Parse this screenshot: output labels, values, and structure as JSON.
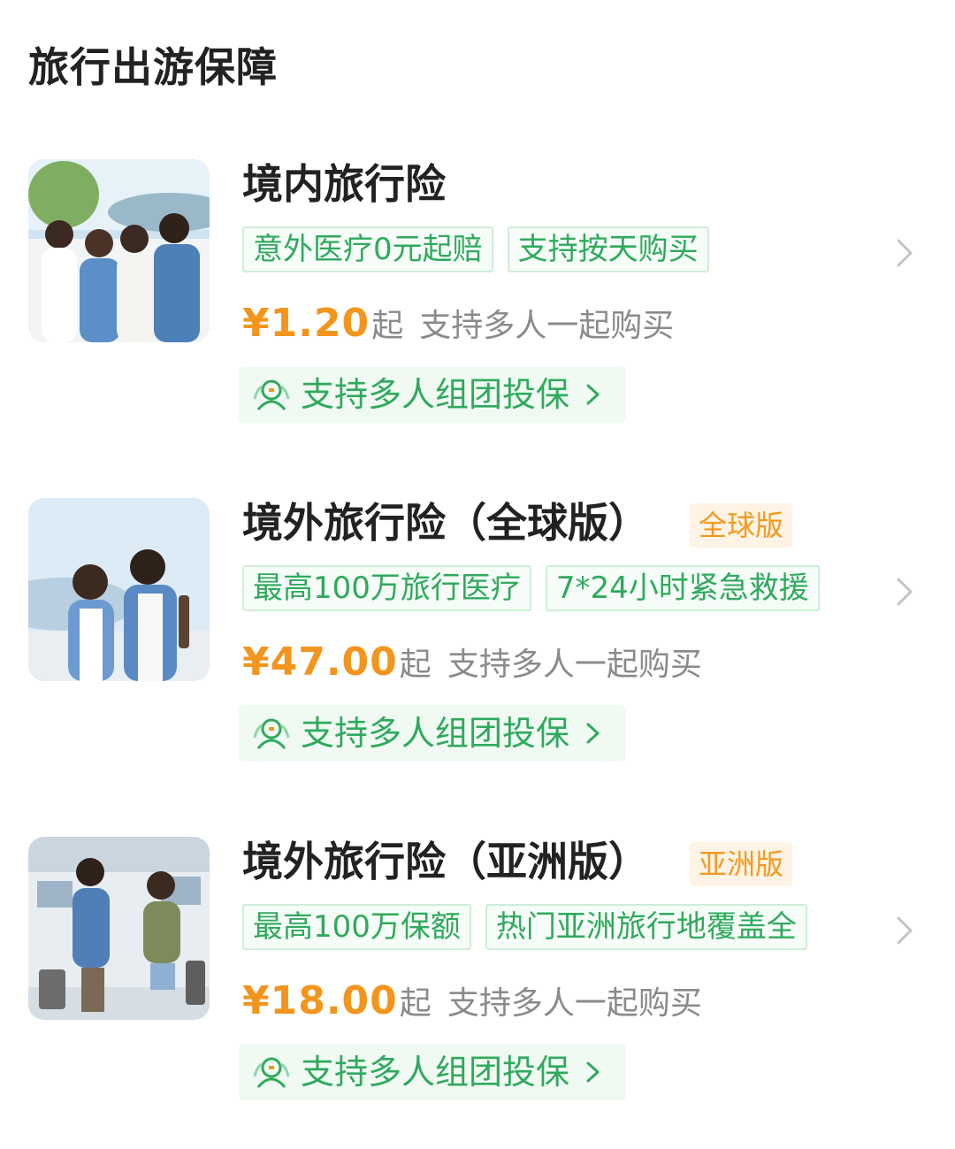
{
  "section": {
    "title": "旅行出游保障"
  },
  "products": [
    {
      "name": "境内旅行险",
      "badge": "",
      "tags": [
        "意外医疗0元起赔",
        "支持按天购买"
      ],
      "price": "¥1.20",
      "price_suffix": "起",
      "price_note": "支持多人一起购买",
      "group_label": "支持多人组团投保",
      "thumb": "group-of-four-friends-photo"
    },
    {
      "name": "境外旅行险（全球版）",
      "badge": "全球版",
      "tags": [
        "最高100万旅行医疗",
        "7*24小时紧急救援"
      ],
      "price": "¥47.00",
      "price_suffix": "起",
      "price_note": "支持多人一起购买",
      "group_label": "支持多人组团投保",
      "thumb": "couple-outdoor-photo"
    },
    {
      "name": "境外旅行险（亚洲版）",
      "badge": "亚洲版",
      "tags": [
        "最高100万保额",
        "热门亚洲旅行地覆盖全"
      ],
      "price": "¥18.00",
      "price_suffix": "起",
      "price_note": "支持多人一起购买",
      "group_label": "支持多人组团投保",
      "thumb": "couple-airport-photo"
    }
  ],
  "colors": {
    "accent_green": "#2faa5c",
    "price_orange": "#f3951d",
    "badge_orange": "#f39a1e"
  },
  "icons": {
    "group_icon": "people-group-icon",
    "chevron": "chevron-right-icon"
  }
}
